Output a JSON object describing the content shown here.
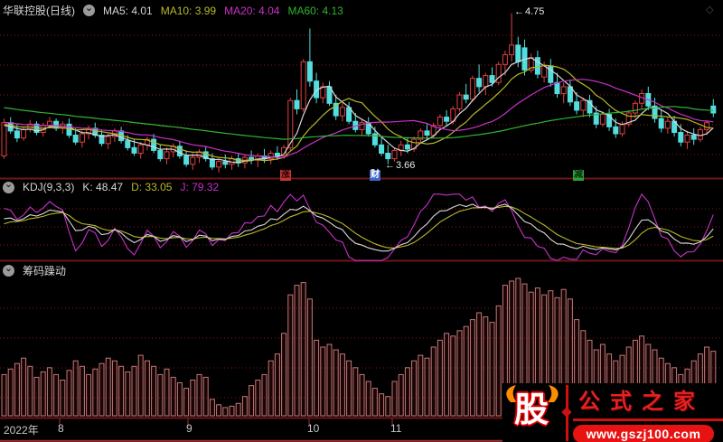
{
  "header": {
    "title": "华联控股(日线)",
    "ma": [
      {
        "text": "MA5: 4.01"
      },
      {
        "text": "MA10: 3.99"
      },
      {
        "text": "MA20: 4.04"
      },
      {
        "text": "MA60: 4.13"
      }
    ]
  },
  "kdj": {
    "name": "KDJ(9,3,3)",
    "k": "K: 48.47",
    "d": "D: 33.05",
    "j": "J: 79.32"
  },
  "chip": {
    "name": "筹码躁动"
  },
  "annotations": {
    "high": "4.75",
    "low": "3.66"
  },
  "markers": [
    {
      "text": "涨",
      "color": "#c23535"
    },
    {
      "text": "财",
      "color": "#3e68cc"
    },
    {
      "text": "减",
      "color": "#2f9e38"
    }
  ],
  "icons": {
    "chevron": "⌄",
    "diamond": "◇",
    "arrow_left": "←"
  },
  "axis": {
    "labels": [
      {
        "text": "2022年"
      },
      {
        "text": "8"
      },
      {
        "text": "9"
      },
      {
        "text": "10"
      },
      {
        "text": "11"
      }
    ]
  },
  "watermark": {
    "logo_char": "股",
    "brand": "公式之家",
    "url": "www.gszj100.com"
  },
  "colors": {
    "up": "#e04040",
    "down": "#52dede",
    "grid": "#8e1515",
    "divider": "#6e1616",
    "ma5": "#d8d8d8",
    "ma10": "#b8b828",
    "ma20": "#c832c8",
    "ma60": "#32b432"
  },
  "chart_data": [
    {
      "type": "candlestick",
      "title": "华联控股 日线",
      "x_tick_labels": [
        "2022年",
        "8",
        "9",
        "10",
        "11"
      ],
      "annotated_high": 4.75,
      "annotated_low": 3.66,
      "up_color": "#e04040",
      "down_color": "#52dede",
      "ma_legend": [
        {
          "name": "MA5",
          "window": 5,
          "value": 4.01,
          "color": "#d8d8d8"
        },
        {
          "name": "MA10",
          "window": 10,
          "value": 3.99,
          "color": "#b8b828"
        },
        {
          "name": "MA20",
          "window": 20,
          "value": 4.04,
          "color": "#c832c8"
        },
        {
          "name": "MA60",
          "window": 60,
          "value": 4.13,
          "color": "#32b432"
        }
      ],
      "pre_closes": [
        4.3,
        4.28,
        4.31,
        4.27,
        4.25,
        4.28,
        4.24,
        4.22,
        4.25,
        4.21,
        4.19,
        4.22,
        4.18,
        4.16,
        4.19,
        4.15,
        4.13,
        4.16,
        4.12,
        4.1,
        4.13,
        4.09,
        4.11,
        4.07,
        4.09,
        4.05,
        4.07,
        4.03,
        4.05,
        4.08,
        4.04,
        4.02,
        4.05,
        4.01,
        4.03,
        3.99,
        4.01,
        4.04,
        4.0,
        3.98,
        4.01,
        3.97,
        3.99,
        4.02,
        3.98,
        3.96,
        3.99,
        3.95,
        3.97,
        4.0,
        3.96,
        3.94,
        3.97,
        3.93,
        3.95,
        3.98,
        3.94,
        3.92,
        3.95,
        3.93
      ],
      "candles": [
        [
          3.72,
          3.99,
          3.7,
          3.96
        ],
        [
          3.96,
          4.0,
          3.88,
          3.9
        ],
        [
          3.9,
          3.95,
          3.82,
          3.85
        ],
        [
          3.85,
          3.93,
          3.83,
          3.91
        ],
        [
          3.91,
          3.98,
          3.89,
          3.95
        ],
        [
          3.95,
          3.97,
          3.87,
          3.89
        ],
        [
          3.89,
          3.96,
          3.86,
          3.94
        ],
        [
          3.94,
          4.0,
          3.92,
          3.97
        ],
        [
          3.97,
          3.99,
          3.9,
          3.92
        ],
        [
          3.92,
          3.97,
          3.88,
          3.95
        ],
        [
          3.95,
          3.99,
          3.85,
          3.87
        ],
        [
          3.87,
          3.92,
          3.8,
          3.82
        ],
        [
          3.82,
          3.9,
          3.78,
          3.88
        ],
        [
          3.88,
          3.94,
          3.84,
          3.92
        ],
        [
          3.92,
          3.96,
          3.85,
          3.87
        ],
        [
          3.87,
          3.91,
          3.79,
          3.81
        ],
        [
          3.81,
          3.88,
          3.77,
          3.86
        ],
        [
          3.86,
          3.92,
          3.82,
          3.9
        ],
        [
          3.9,
          3.93,
          3.81,
          3.83
        ],
        [
          3.83,
          3.87,
          3.76,
          3.78
        ],
        [
          3.78,
          3.84,
          3.72,
          3.74
        ],
        [
          3.74,
          3.82,
          3.7,
          3.8
        ],
        [
          3.8,
          3.86,
          3.76,
          3.84
        ],
        [
          3.84,
          3.88,
          3.74,
          3.76
        ],
        [
          3.76,
          3.8,
          3.68,
          3.7
        ],
        [
          3.7,
          3.78,
          3.66,
          3.75
        ],
        [
          3.75,
          3.81,
          3.71,
          3.79
        ],
        [
          3.79,
          3.83,
          3.7,
          3.72
        ],
        [
          3.72,
          3.76,
          3.64,
          3.66
        ],
        [
          3.66,
          3.74,
          3.62,
          3.71
        ],
        [
          3.71,
          3.77,
          3.67,
          3.75
        ],
        [
          3.75,
          3.79,
          3.68,
          3.7
        ],
        [
          3.7,
          3.74,
          3.62,
          3.64
        ],
        [
          3.64,
          3.7,
          3.6,
          3.68
        ],
        [
          3.68,
          3.73,
          3.63,
          3.66
        ],
        [
          3.66,
          3.72,
          3.62,
          3.7
        ],
        [
          3.7,
          3.74,
          3.64,
          3.67
        ],
        [
          3.67,
          3.73,
          3.63,
          3.71
        ],
        [
          3.71,
          3.76,
          3.66,
          3.69
        ],
        [
          3.69,
          3.74,
          3.64,
          3.72
        ],
        [
          3.72,
          3.77,
          3.67,
          3.7
        ],
        [
          3.7,
          3.76,
          3.66,
          3.74
        ],
        [
          3.74,
          3.79,
          3.69,
          3.72
        ],
        [
          3.72,
          3.8,
          3.7,
          3.78
        ],
        [
          3.78,
          4.14,
          3.76,
          4.12
        ],
        [
          4.12,
          4.2,
          4.02,
          4.06
        ],
        [
          4.06,
          4.42,
          4.04,
          4.4
        ],
        [
          4.4,
          4.64,
          4.22,
          4.26
        ],
        [
          4.26,
          4.32,
          4.1,
          4.14
        ],
        [
          4.14,
          4.25,
          4.1,
          4.22
        ],
        [
          4.22,
          4.26,
          4.08,
          4.1
        ],
        [
          4.1,
          4.16,
          3.98,
          4.01
        ],
        [
          4.01,
          4.1,
          3.97,
          4.07
        ],
        [
          4.07,
          4.11,
          3.95,
          3.97
        ],
        [
          3.97,
          4.03,
          3.89,
          3.91
        ],
        [
          3.91,
          3.99,
          3.87,
          3.96
        ],
        [
          3.96,
          4.0,
          3.86,
          3.88
        ],
        [
          3.88,
          3.93,
          3.78,
          3.8
        ],
        [
          3.8,
          3.86,
          3.72,
          3.74
        ],
        [
          3.74,
          3.8,
          3.66,
          3.7
        ],
        [
          3.7,
          3.78,
          3.68,
          3.76
        ],
        [
          3.76,
          3.83,
          3.72,
          3.8
        ],
        [
          3.8,
          3.85,
          3.74,
          3.77
        ],
        [
          3.77,
          3.86,
          3.75,
          3.84
        ],
        [
          3.84,
          3.92,
          3.82,
          3.9
        ],
        [
          3.9,
          3.95,
          3.84,
          3.87
        ],
        [
          3.87,
          3.96,
          3.85,
          3.94
        ],
        [
          3.94,
          4.02,
          3.92,
          4.0
        ],
        [
          4.0,
          4.05,
          3.94,
          3.97
        ],
        [
          3.97,
          4.08,
          3.95,
          4.06
        ],
        [
          4.06,
          4.18,
          4.04,
          4.16
        ],
        [
          4.16,
          4.24,
          4.1,
          4.13
        ],
        [
          4.13,
          4.3,
          4.11,
          4.28
        ],
        [
          4.28,
          4.38,
          4.18,
          4.22
        ],
        [
          4.22,
          4.32,
          4.16,
          4.3
        ],
        [
          4.3,
          4.36,
          4.22,
          4.25
        ],
        [
          4.25,
          4.4,
          4.23,
          4.38
        ],
        [
          4.38,
          4.48,
          4.3,
          4.45
        ],
        [
          4.45,
          4.75,
          4.4,
          4.52
        ],
        [
          4.52,
          4.58,
          4.36,
          4.4
        ],
        [
          4.5,
          4.56,
          4.3,
          4.34
        ],
        [
          4.34,
          4.46,
          4.32,
          4.43
        ],
        [
          4.43,
          4.48,
          4.28,
          4.31
        ],
        [
          4.29,
          4.4,
          4.25,
          4.37
        ],
        [
          4.37,
          4.42,
          4.22,
          4.25
        ],
        [
          4.25,
          4.32,
          4.14,
          4.17
        ],
        [
          4.17,
          4.25,
          4.1,
          4.22
        ],
        [
          4.22,
          4.27,
          4.08,
          4.11
        ],
        [
          4.11,
          4.18,
          4.02,
          4.05
        ],
        [
          4.05,
          4.14,
          4.0,
          4.12
        ],
        [
          4.12,
          4.16,
          4.0,
          4.03
        ],
        [
          4.03,
          4.08,
          3.92,
          3.95
        ],
        [
          3.95,
          4.04,
          3.93,
          4.02
        ],
        [
          4.02,
          4.06,
          3.9,
          3.93
        ],
        [
          3.93,
          3.99,
          3.85,
          3.88
        ],
        [
          3.88,
          3.97,
          3.86,
          3.95
        ],
        [
          3.95,
          4.05,
          3.93,
          4.03
        ],
        [
          4.03,
          4.12,
          3.99,
          4.1
        ],
        [
          4.1,
          4.2,
          4.06,
          4.17
        ],
        [
          4.17,
          4.22,
          4.05,
          4.08
        ],
        [
          4.08,
          4.14,
          3.96,
          3.99
        ],
        [
          3.99,
          4.05,
          3.89,
          3.92
        ],
        [
          3.92,
          4.0,
          3.88,
          3.97
        ],
        [
          3.97,
          4.01,
          3.86,
          3.89
        ],
        [
          3.89,
          3.95,
          3.79,
          3.82
        ],
        [
          3.82,
          3.9,
          3.77,
          3.87
        ],
        [
          3.87,
          3.92,
          3.8,
          3.84
        ],
        [
          3.84,
          3.93,
          3.82,
          3.91
        ],
        [
          3.91,
          3.98,
          3.87,
          3.96
        ],
        [
          4.08,
          4.13,
          4.0,
          4.03
        ]
      ]
    },
    {
      "type": "line",
      "name": "KDJ(9,3,3)",
      "params": [
        9,
        3,
        3
      ],
      "latest": {
        "K": 48.47,
        "D": 33.05,
        "J": 79.32
      },
      "colors": {
        "K": "#d8d8d8",
        "D": "#b8b828",
        "J": "#c832c8"
      },
      "range": [
        0,
        100
      ],
      "gridlines_at": [
        20,
        50,
        80
      ],
      "note": "K/D/J series computed from candles with standard KDJ(9,3,3) smoothing"
    },
    {
      "type": "bar",
      "name": "筹码躁动",
      "bar_color": "#c47777",
      "values_pct": [
        30,
        34,
        38,
        42,
        36,
        28,
        32,
        35,
        30,
        26,
        33,
        40,
        36,
        30,
        34,
        38,
        42,
        40,
        36,
        32,
        36,
        44,
        40,
        36,
        30,
        34,
        28,
        24,
        20,
        26,
        30,
        28,
        12,
        8,
        6,
        7,
        9,
        14,
        22,
        26,
        30,
        40,
        45,
        60,
        88,
        95,
        97,
        85,
        55,
        50,
        52,
        48,
        45,
        40,
        35,
        30,
        25,
        20,
        16,
        14,
        25,
        30,
        35,
        40,
        44,
        42,
        50,
        55,
        60,
        58,
        62,
        65,
        70,
        75,
        72,
        68,
        80,
        95,
        98,
        100,
        96,
        90,
        93,
        88,
        91,
        86,
        92,
        85,
        70,
        62,
        55,
        48,
        52,
        45,
        40,
        44,
        50,
        55,
        58,
        52,
        48,
        42,
        38,
        35,
        30,
        34,
        40,
        45,
        50,
        47
      ]
    }
  ]
}
